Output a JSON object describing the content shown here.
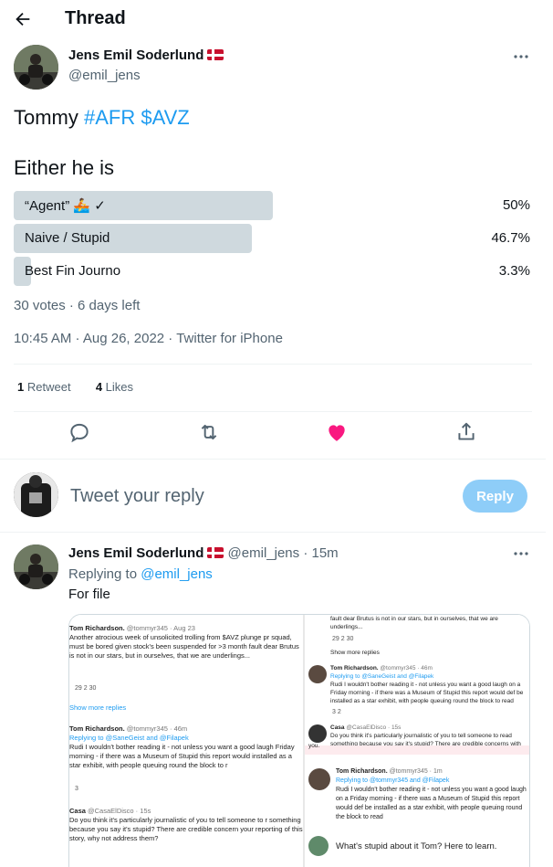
{
  "header": {
    "title": "Thread"
  },
  "tweet": {
    "name": "Jens Emil Soderlund",
    "handle": "@emil_jens",
    "text_plain": "Tommy ",
    "text_links": "#AFR $AVZ",
    "question": "Either he is",
    "poll": {
      "options": [
        {
          "label": "“Agent” 🚣 ✓",
          "percent_label": "50%",
          "fraction": 0.5
        },
        {
          "label": "Naive / Stupid",
          "percent_label": "46.7%",
          "fraction": 0.467
        },
        {
          "label": "Best Fin Journo",
          "percent_label": "3.3%",
          "fraction": 0.033
        }
      ],
      "meta": "30 votes · 6 days left"
    },
    "timestamp": "10:45 AM · Aug 26, 2022 · ",
    "source": "Twitter for iPhone",
    "stats": {
      "retweets_count": "1",
      "retweets_label": "Retweet",
      "likes_count": "4",
      "likes_label": "Likes"
    }
  },
  "reply_box": {
    "placeholder": "Tweet your reply",
    "button": "Reply"
  },
  "reply": {
    "name": "Jens Emil Soderlund",
    "handle": "@emil_jens",
    "time": "· 15m",
    "replying_prefix": "Replying to ",
    "replying_to": "@emil_jens",
    "text": "For file"
  },
  "media": {
    "left": {
      "t1_name": "Tom Richardson.",
      "t1_meta": "@tommyr345 · Aug 23",
      "t1_body": "Another atrocious week of unsolicited trolling from $AVZ plunge pr squad, must be bored given stock's been suspended for >3 month fault dear Brutus is not in our stars, but in ourselves, that we are underlings...",
      "t1_counts": "29          2          30",
      "t1_more": "Show more replies",
      "t2_name": "Tom Richardson.",
      "t2_meta": "@tommyr345 · 46m",
      "t2_reply": "Replying to @SaneGeist and @Filapek",
      "t2_body": "Rudi I wouldn't bother reading it - not unless you want a good laugh Friday morning - if there was a Museum of Stupid this report would installed as a star exhibit, with people queuing round the block to r",
      "t2_counts": "3",
      "t3_name": "Casa",
      "t3_meta": "@CasaElDisco · 15s",
      "t3_body": "Do you think it's particularly journalistic of you to tell someone to r something because you say it's stupid? There are credible concern your reporting of this story, why not address them?"
    },
    "right": {
      "r0_body": "fault dear Brutus is not in our stars, but in ourselves, that we are underlings...",
      "r0_counts": "29          2          30",
      "r0_more": "Show more replies",
      "r1_name": "Tom Richardson.",
      "r1_meta": "@tommyr345 · 46m",
      "r1_reply": "Replying to @SaneGeist and @Filapek",
      "r1_body": "Rudi I wouldn't bother reading it - not unless you want a good laugh on a Friday morning - if there was a Museum of Stupid this report would def be installed as a star exhibit, with people queuing round the block to read",
      "r1_counts": "3          2",
      "r2_name": "Casa",
      "r2_meta": "@CasaElDisco · 15s",
      "r2_body": "Do you think it's particularly journalistic of you to tell someone to read something because you say it's stupid? There are credible concerns with",
      "r2_tail": "you.",
      "r3_name": "Tom Richardson.",
      "r3_meta": "@tommyr345 · 1m",
      "r3_reply": "Replying to @tommyr345 and @Filapek",
      "r3_body": "Rudi I wouldn't bother reading it - not unless you want a good laugh on a Friday morning - if there was a Museum of Stupid this report would def be installed as a star exhibit, with people queuing round the block to read",
      "r4_body": "What's stupid about it Tom? Here to learn."
    }
  },
  "colors": {
    "accent": "#1d9bf0",
    "like": "#f91880",
    "poll_bar": "#cfd9de",
    "reply_button": "#8ecdf8"
  }
}
